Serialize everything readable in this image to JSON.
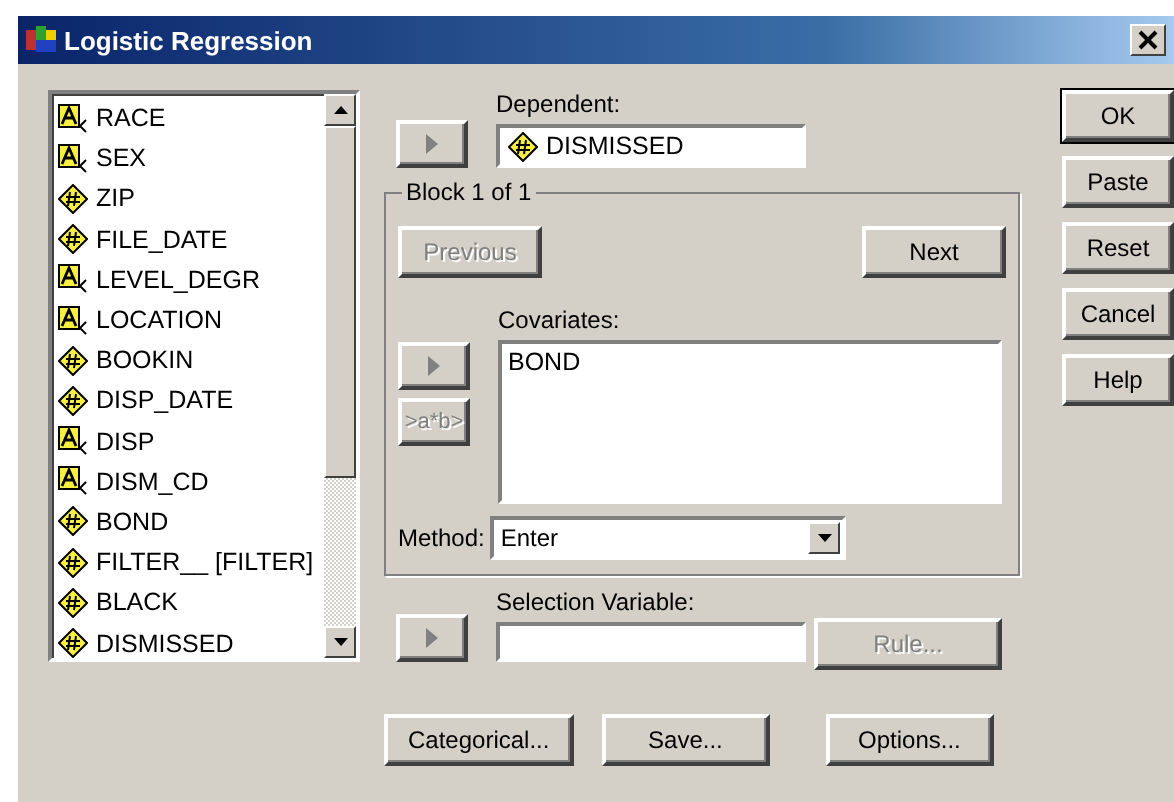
{
  "window": {
    "title": "Logistic Regression"
  },
  "variables": [
    {
      "name": "RACE",
      "kind": "string"
    },
    {
      "name": "SEX",
      "kind": "string"
    },
    {
      "name": "ZIP",
      "kind": "numeric"
    },
    {
      "name": "FILE_DATE",
      "kind": "numeric"
    },
    {
      "name": "LEVEL_DEGR",
      "kind": "string"
    },
    {
      "name": "LOCATION",
      "kind": "string"
    },
    {
      "name": "BOOKIN",
      "kind": "numeric"
    },
    {
      "name": "DISP_DATE",
      "kind": "numeric"
    },
    {
      "name": "DISP",
      "kind": "string"
    },
    {
      "name": "DISM_CD",
      "kind": "string"
    },
    {
      "name": "BOND",
      "kind": "numeric"
    },
    {
      "name": "FILTER__ [FILTER]",
      "kind": "numeric"
    },
    {
      "name": "BLACK",
      "kind": "numeric"
    },
    {
      "name": "DISMISSED",
      "kind": "numeric"
    }
  ],
  "dependent": {
    "label": "Dependent:",
    "value": "DISMISSED",
    "kind": "numeric"
  },
  "block": {
    "title": "Block 1 of 1",
    "buttons": [
      {
        "label": "Previous",
        "disabled": true
      },
      {
        "label": "Next",
        "disabled": false
      }
    ],
    "covariates_label": "Covariates:",
    "covariates": [
      "BOND"
    ],
    "interaction_button": {
      "label": ">a*b>",
      "disabled": true
    },
    "method_label": "Method:",
    "method": "Enter"
  },
  "selection": {
    "label": "Selection Variable:",
    "rule_button": {
      "label": "Rule...",
      "disabled": true
    }
  },
  "bottom_buttons": [
    "Categorical...",
    "Save...",
    "Options..."
  ],
  "side_buttons": [
    {
      "label": "OK",
      "default": true
    },
    {
      "label": "Paste",
      "default": false
    },
    {
      "label": "Reset",
      "default": false
    },
    {
      "label": "Cancel",
      "default": false
    },
    {
      "label": "Help",
      "default": false
    }
  ]
}
